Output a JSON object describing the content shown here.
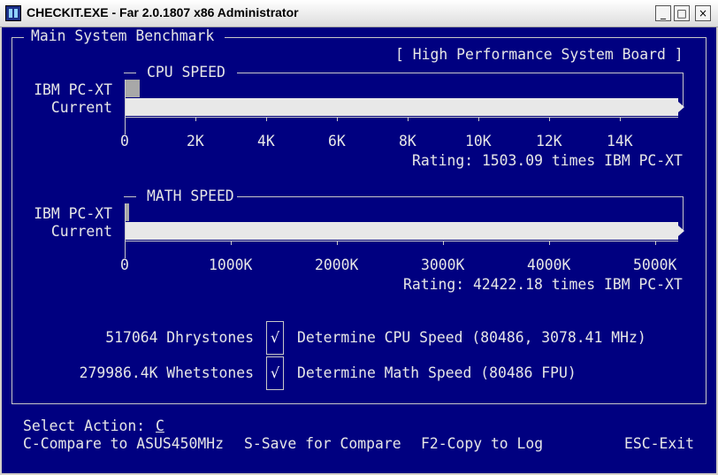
{
  "window": {
    "title": "CHECKIT.EXE - Far 2.0.1807 x86 Administrator",
    "minimize": "_",
    "maximize": "□",
    "close": "×"
  },
  "panel": {
    "title": "Main System Benchmark",
    "board": "[ High Performance System Board ]"
  },
  "cpu": {
    "section": "CPU SPEED",
    "label_ref": "IBM PC-XT",
    "label_cur": "Current",
    "ticks": [
      "0",
      "2K",
      "4K",
      "6K",
      "8K",
      "10K",
      "12K",
      "14K"
    ],
    "rating": "Rating: 1503.09 times IBM PC-XT",
    "ref_value": 0.026,
    "current_value": 1.0
  },
  "math": {
    "section": "MATH SPEED",
    "label_ref": "IBM PC-XT",
    "label_cur": "Current",
    "ticks": [
      "0",
      "1000K",
      "2000K",
      "3000K",
      "4000K",
      "5000K"
    ],
    "rating": "Rating: 42422.18 times IBM PC-XT",
    "ref_value": 0.006,
    "current_value": 1.0
  },
  "tests": [
    {
      "value": "517064 Dhrystones",
      "check": "√",
      "desc": "Determine CPU Speed (80486, 3078.41 MHz)"
    },
    {
      "value": "279986.4K Whetstones",
      "check": "√",
      "desc": "Determine Math Speed (80486 FPU)"
    }
  ],
  "footer": {
    "select_label": "Select Action:",
    "select_value": "C",
    "compare": "C-Compare to ASUS450MHz",
    "save": "S-Save for Compare",
    "copy": "F2-Copy to Log",
    "exit": "ESC-Exit"
  }
}
